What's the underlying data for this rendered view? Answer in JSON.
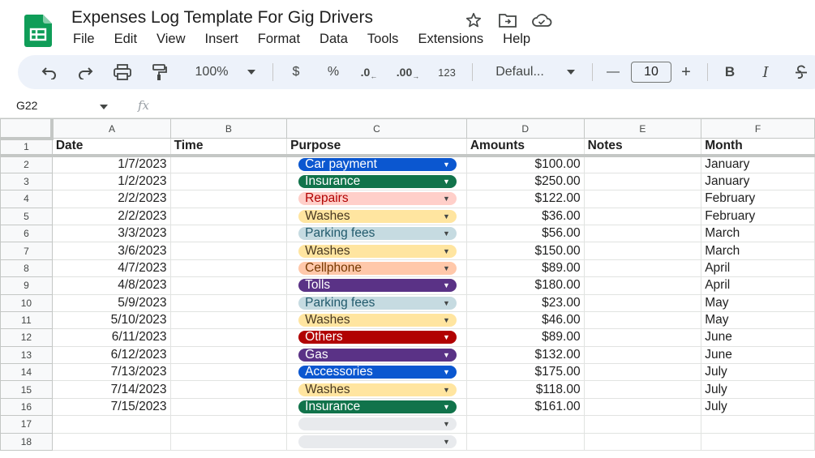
{
  "doc": {
    "title": "Expenses Log Template For Gig Drivers"
  },
  "menu": [
    "File",
    "Edit",
    "View",
    "Insert",
    "Format",
    "Data",
    "Tools",
    "Extensions",
    "Help"
  ],
  "toolbar": {
    "zoom": "100%",
    "currency": "$",
    "percent": "%",
    "dec_decrease": ".0",
    "dec_increase": ".00",
    "number_format": "123",
    "font": "Defaul...",
    "font_size": "10",
    "minus": "—",
    "plus": "+",
    "bold": "B",
    "italic": "I"
  },
  "formula_bar": {
    "cell_ref": "G22",
    "fx": "fx"
  },
  "columns": [
    "A",
    "B",
    "C",
    "D",
    "E",
    "F"
  ],
  "headers": [
    "Date",
    "Time",
    "Purpose",
    "Amounts",
    "Notes",
    "Month"
  ],
  "rows": [
    {
      "n": "2",
      "date": "1/7/2023",
      "time": "",
      "purpose": "Car payment",
      "amount": "$100.00",
      "notes": "",
      "month": "January",
      "bg": "#0b57d0",
      "fg": "#ffffff"
    },
    {
      "n": "3",
      "date": "1/2/2023",
      "time": "",
      "purpose": "Insurance",
      "amount": "$250.00",
      "notes": "",
      "month": "January",
      "bg": "#11734b",
      "fg": "#ffffff"
    },
    {
      "n": "4",
      "date": "2/2/2023",
      "time": "",
      "purpose": "Repairs",
      "amount": "$122.00",
      "notes": "",
      "month": "February",
      "bg": "#ffcfc9",
      "fg": "#b10202"
    },
    {
      "n": "5",
      "date": "2/2/2023",
      "time": "",
      "purpose": "Washes",
      "amount": "$36.00",
      "notes": "",
      "month": "February",
      "bg": "#ffe5a0",
      "fg": "#473821"
    },
    {
      "n": "6",
      "date": "3/3/2023",
      "time": "",
      "purpose": "Parking fees",
      "amount": "$56.00",
      "notes": "",
      "month": "March",
      "bg": "#c6dbe1",
      "fg": "#215a6c"
    },
    {
      "n": "7",
      "date": "3/6/2023",
      "time": "",
      "purpose": "Washes",
      "amount": "$150.00",
      "notes": "",
      "month": "March",
      "bg": "#ffe5a0",
      "fg": "#473821"
    },
    {
      "n": "8",
      "date": "4/7/2023",
      "time": "",
      "purpose": "Cellphone",
      "amount": "$89.00",
      "notes": "",
      "month": "April",
      "bg": "#ffc8aa",
      "fg": "#753800"
    },
    {
      "n": "9",
      "date": "4/8/2023",
      "time": "",
      "purpose": "Tolls",
      "amount": "$180.00",
      "notes": "",
      "month": "April",
      "bg": "#5a3286",
      "fg": "#ffffff"
    },
    {
      "n": "10",
      "date": "5/9/2023",
      "time": "",
      "purpose": "Parking fees",
      "amount": "$23.00",
      "notes": "",
      "month": "May",
      "bg": "#c6dbe1",
      "fg": "#215a6c"
    },
    {
      "n": "11",
      "date": "5/10/2023",
      "time": "",
      "purpose": "Washes",
      "amount": "$46.00",
      "notes": "",
      "month": "May",
      "bg": "#ffe5a0",
      "fg": "#473821"
    },
    {
      "n": "12",
      "date": "6/11/2023",
      "time": "",
      "purpose": "Others",
      "amount": "$89.00",
      "notes": "",
      "month": "June",
      "bg": "#b10202",
      "fg": "#ffffff"
    },
    {
      "n": "13",
      "date": "6/12/2023",
      "time": "",
      "purpose": "Gas",
      "amount": "$132.00",
      "notes": "",
      "month": "June",
      "bg": "#5a3286",
      "fg": "#ffffff"
    },
    {
      "n": "14",
      "date": "7/13/2023",
      "time": "",
      "purpose": "Accessories",
      "amount": "$175.00",
      "notes": "",
      "month": "July",
      "bg": "#0b57d0",
      "fg": "#ffffff"
    },
    {
      "n": "15",
      "date": "7/14/2023",
      "time": "",
      "purpose": "Washes",
      "amount": "$118.00",
      "notes": "",
      "month": "July",
      "bg": "#ffe5a0",
      "fg": "#473821"
    },
    {
      "n": "16",
      "date": "7/15/2023",
      "time": "",
      "purpose": "Insurance",
      "amount": "$161.00",
      "notes": "",
      "month": "July",
      "bg": "#11734b",
      "fg": "#ffffff"
    },
    {
      "n": "17",
      "date": "",
      "time": "",
      "purpose": "",
      "amount": "",
      "notes": "",
      "month": "",
      "bg": "#e8eaed",
      "fg": "#1f1f1f"
    },
    {
      "n": "18",
      "date": "",
      "time": "",
      "purpose": "",
      "amount": "",
      "notes": "",
      "month": "",
      "bg": "#e8eaed",
      "fg": "#1f1f1f"
    }
  ],
  "header_row_num": "1",
  "colors": {
    "sheets_green": "#0f9d58",
    "toolbar_bg": "#edf2fa",
    "grid_line": "#e1e3e1"
  }
}
